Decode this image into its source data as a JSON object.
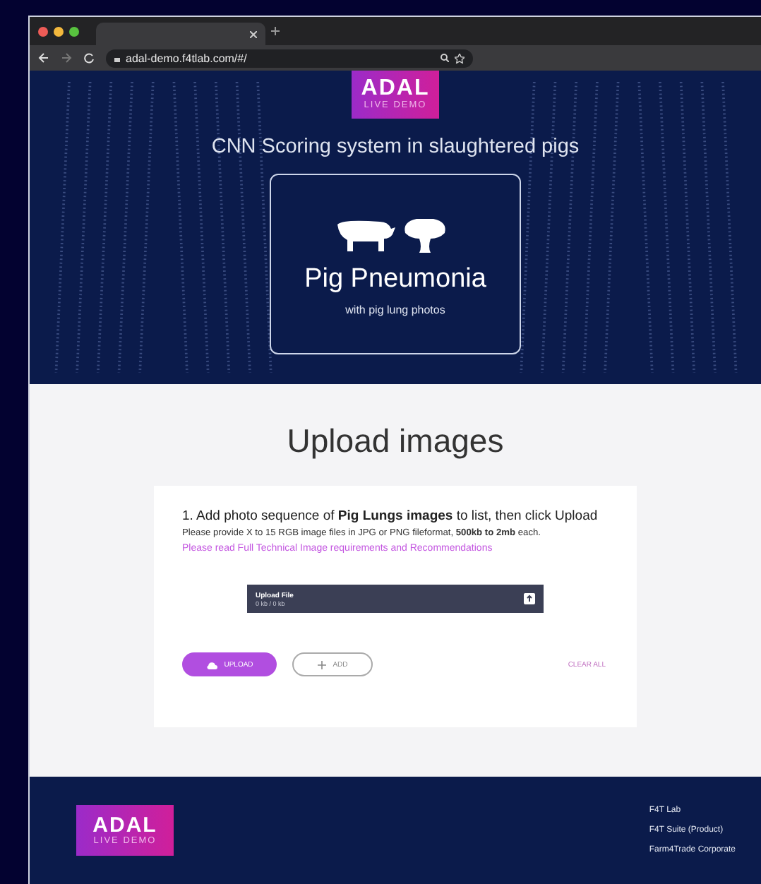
{
  "browser": {
    "url": "adal-demo.f4tlab.com/#/"
  },
  "hero": {
    "logo": {
      "title": "ADAL",
      "subtitle": "LIVE DEMO"
    },
    "heading": "CNN Scoring system in slaughtered pigs",
    "card": {
      "title": "Pig Pneumonia",
      "subtitle": "with pig lung photos"
    }
  },
  "upload": {
    "title": "Upload images",
    "instruction": "1. Add photo sequence of **Pig Lungs images** to list, then click Upload",
    "requirements": "Please provide X to 15 RGB image files in JPG or PNG fileformat, **500kb to 2mb** each.",
    "link": "Please read Full Technical Image requirements and Recommendations",
    "file_bar": {
      "label": "Upload File",
      "sub": "0 kb / 0 kb"
    },
    "buttons": [
      {
        "kind": "primary",
        "label": "UPLOAD"
      },
      {
        "kind": "outline",
        "label": "ADD"
      },
      {
        "kind": "text",
        "label": "CLEAR ALL"
      }
    ]
  },
  "footer": {
    "logo": {
      "title": "ADAL",
      "subtitle": "LIVE DEMO"
    },
    "links": [
      "F4T Lab",
      "F4T Suite (Product)",
      "Farm4Trade Corporate"
    ]
  }
}
